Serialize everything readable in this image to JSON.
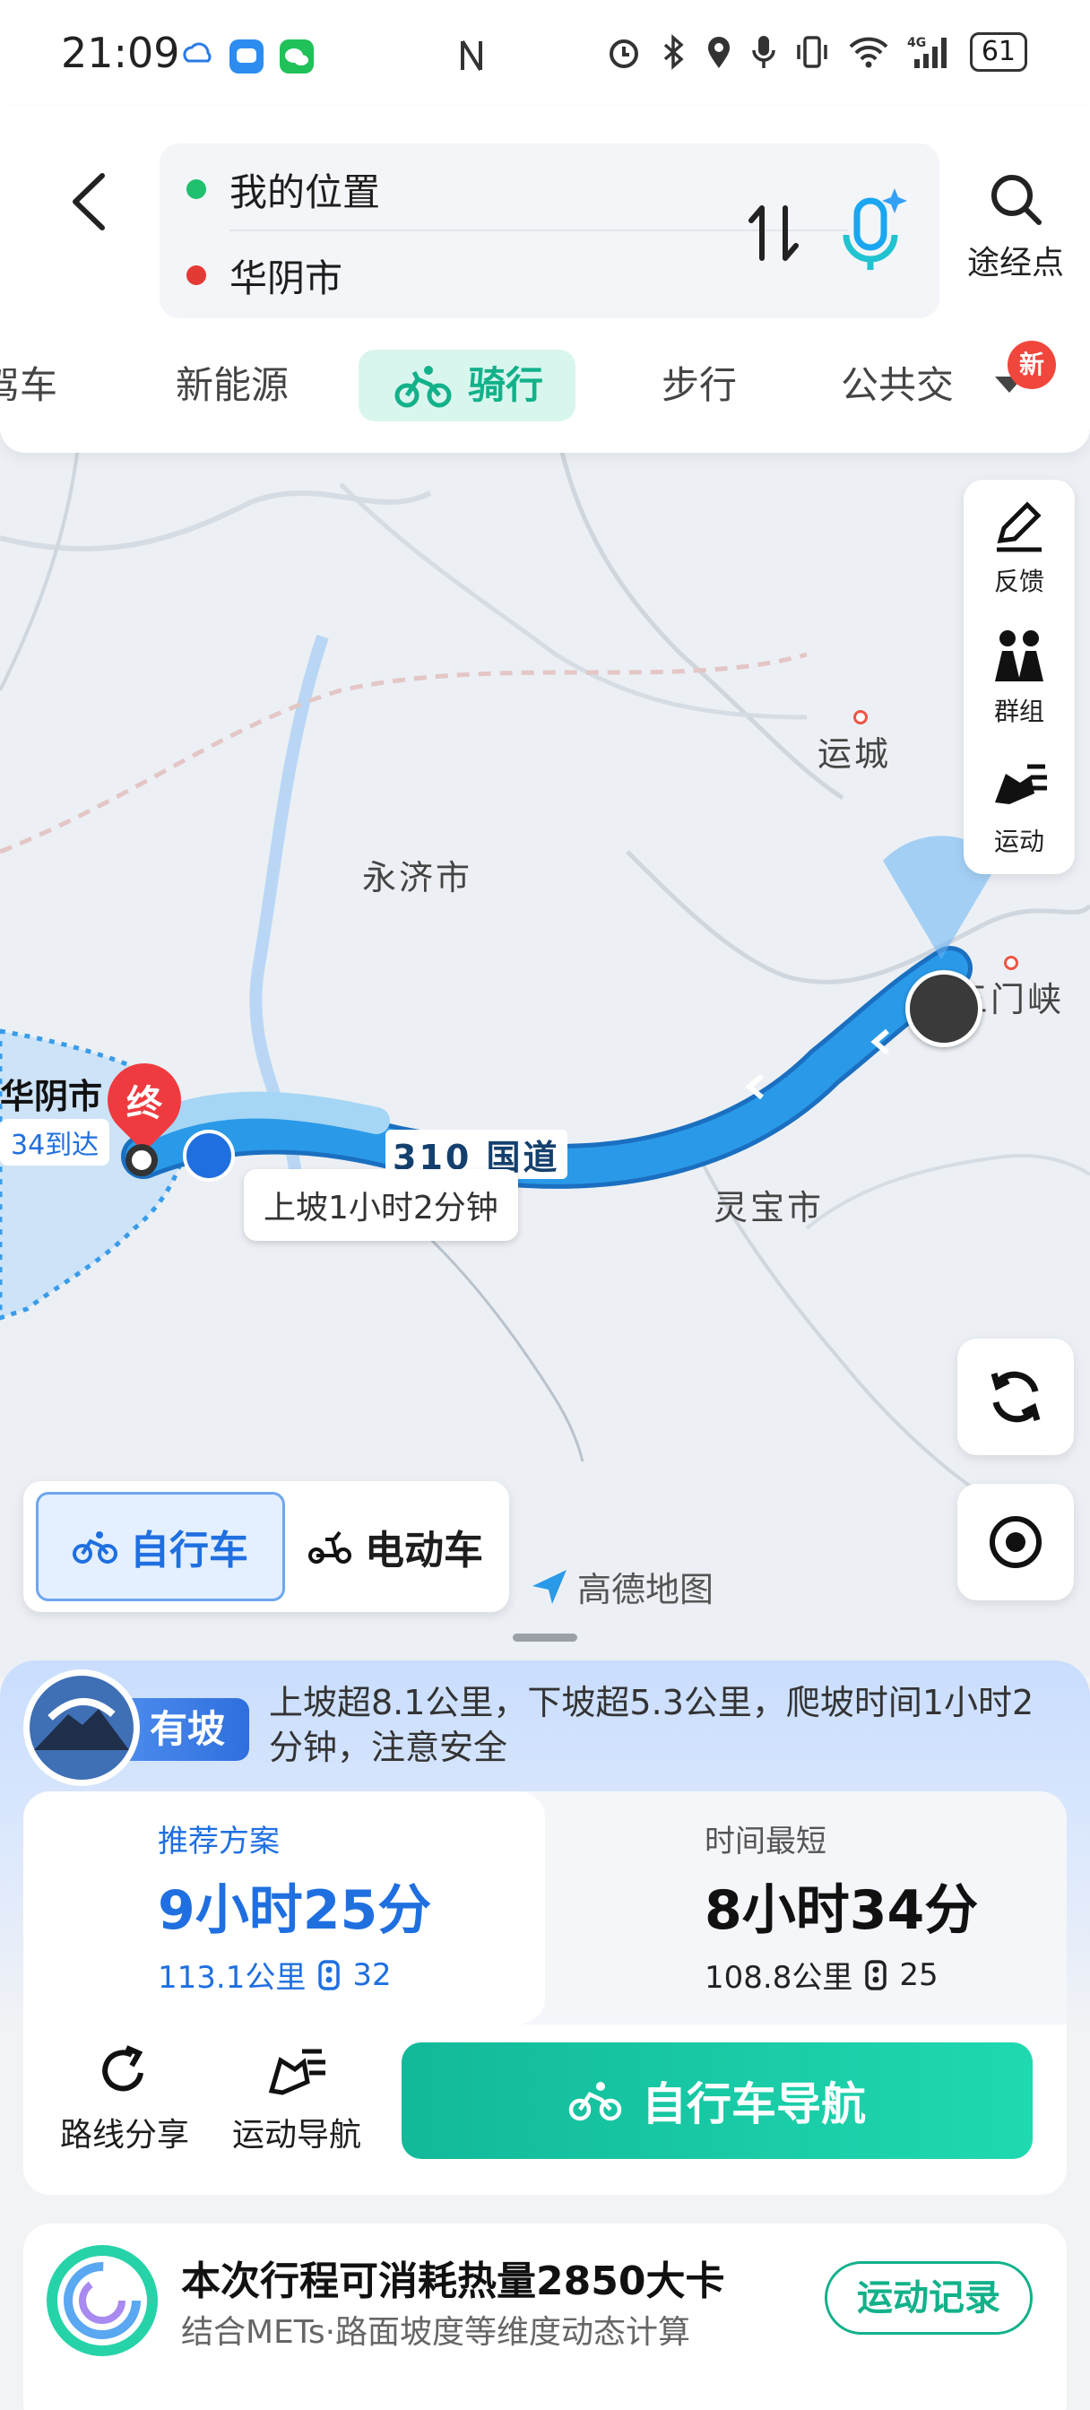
{
  "status_bar": {
    "time": "21:09",
    "battery": "61"
  },
  "route_search": {
    "origin": "我的位置",
    "destination": "华阴市",
    "waypoint_label": "途经点",
    "origin_color": "#1fc06e",
    "destination_color": "#e53935"
  },
  "mode_tabs": {
    "items": [
      {
        "label": "驾车"
      },
      {
        "label": "新能源"
      },
      {
        "label": "骑行"
      },
      {
        "label": "步行"
      },
      {
        "label": "公共交"
      }
    ],
    "active": "骑行",
    "new_badge": "新"
  },
  "map": {
    "labels": {
      "yuncheng": "运城",
      "yongji": "永济市",
      "sanmenxia": "三门峡",
      "lingbao": "灵宝市",
      "huayin": "华阴市",
      "highway": "310 国道"
    },
    "end_marker": "终",
    "eta_hint": "34到达",
    "route_tip": "上坡1小时2分钟",
    "logo": "高德地图",
    "side_tools": [
      {
        "label": "反馈"
      },
      {
        "label": "群组"
      },
      {
        "label": "运动"
      }
    ]
  },
  "vehicle_toggle": {
    "bicycle": "自行车",
    "ebike": "电动车",
    "active": "自行车"
  },
  "slope": {
    "tag": "有坡",
    "text": "上坡超8.1公里，下坡超5.3公里，爬坡时间1小时2分钟，注意安全"
  },
  "plans": [
    {
      "tag": "推荐方案",
      "time": "9小时25分",
      "distance": "113.1公里",
      "lights": "32"
    },
    {
      "tag": "时间最短",
      "time": "8小时34分",
      "distance": "108.8公里",
      "lights": "25"
    }
  ],
  "actions": {
    "share": "路线分享",
    "sport_nav": "运动导航",
    "navigate": "自行车导航"
  },
  "calorie": {
    "title": "本次行程可消耗热量2850大卡",
    "subtitle": "结合METs·路面坡度等维度动态计算",
    "button": "运动记录"
  },
  "colors": {
    "accent_green": "#12b18a",
    "accent_blue": "#1f6fe0",
    "route_blue": "#2a9ae8"
  }
}
